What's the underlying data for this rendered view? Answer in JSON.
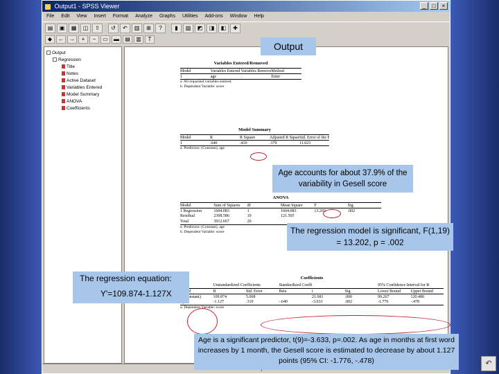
{
  "window": {
    "title": "Output1 - SPSS Viewer",
    "controls": [
      "_",
      "□",
      "×"
    ]
  },
  "menu": [
    "File",
    "Edit",
    "View",
    "Insert",
    "Format",
    "Analyze",
    "Graphs",
    "Utilities",
    "Add-ons",
    "Window",
    "Help"
  ],
  "outline": [
    {
      "label": "Output",
      "level": 0
    },
    {
      "label": "Regression",
      "level": 1
    },
    {
      "label": "Title",
      "level": 2
    },
    {
      "label": "Notes",
      "level": 2
    },
    {
      "label": "Active Dataset",
      "level": 2
    },
    {
      "label": "Variables Entered",
      "level": 2
    },
    {
      "label": "Model Summary",
      "level": 2
    },
    {
      "label": "ANOVA",
      "level": 2
    },
    {
      "label": "Coefficients",
      "level": 2
    }
  ],
  "tables": {
    "variables": {
      "title": "Variables Entered/Removed",
      "headers": [
        "Model",
        "Variables Entered",
        "Variables Removed",
        "Method"
      ],
      "rows": [
        [
          "1",
          "age",
          ".",
          "Enter"
        ]
      ],
      "notes": [
        "a. All requested variables entered.",
        "b. Dependent Variable: score"
      ]
    },
    "summary": {
      "title": "Model Summary",
      "headers": [
        "Model",
        "R",
        "R Square",
        "Adjusted R Square",
        "Std. Error of the Estimate"
      ],
      "rows": [
        [
          "1",
          ".640",
          ".410",
          ".379",
          "11.023"
        ]
      ],
      "notes": [
        "a. Predictors: (Constant), age"
      ]
    },
    "anova": {
      "title": "ANOVA",
      "headers": [
        "Model",
        "Sum of Squares",
        "df",
        "Mean Square",
        "F",
        "Sig."
      ],
      "rows": [
        [
          "1  Regression",
          "1604.083",
          "1",
          "1604.083",
          "13.202",
          ".002"
        ],
        [
          "Residual",
          "2308.586",
          "19",
          "121.505",
          "",
          ""
        ],
        [
          "Total",
          "3912.667",
          "20",
          "",
          "",
          ""
        ]
      ],
      "notes": [
        "a. Predictors: (Constant), age",
        "b. Dependent Variable: score"
      ]
    },
    "coefficients": {
      "title": "Coefficients",
      "headers": [
        "Model",
        "B",
        "Std. Error",
        "Beta",
        "t",
        "Sig.",
        "Lower Bound",
        "Upper Bound"
      ],
      "group_headers": [
        "Unstandardized Coefficients",
        "Standardized Coefficients",
        "95% Confidence Interval for B"
      ],
      "rows": [
        [
          "1  (Constant)",
          "109.874",
          "5.068",
          "",
          "21.681",
          ".000",
          "99.267",
          "120.480"
        ],
        [
          "age",
          "-1.127",
          ".310",
          "-.640",
          "-3.633",
          ".002",
          "-1.776",
          "-.478"
        ]
      ],
      "notes": [
        "a. Dependent Variable: score"
      ]
    }
  },
  "callouts": {
    "output": "Output",
    "r_square": "Age accounts for about 37.9% of the variability in Gesell score",
    "anova": "The regression  model is significant, F(1,19) = 13.202, p = .002",
    "equation_label": "The regression equation:",
    "equation": "Y'=109.874-1.127X",
    "coefficients": "Age is a significant predictor, t(9)=-3.633, p=.002. As age in months at first word increases by 1 month, the Gesell score is estimated to decrease by about 1.127 points (95% CI: -1.776, -.478)"
  },
  "status": "SPSS Processor is ready",
  "colors": {
    "callout_bg": "#a7c6ea",
    "highlight": "#c0202a",
    "slide_bg": "#1b2f6e"
  }
}
